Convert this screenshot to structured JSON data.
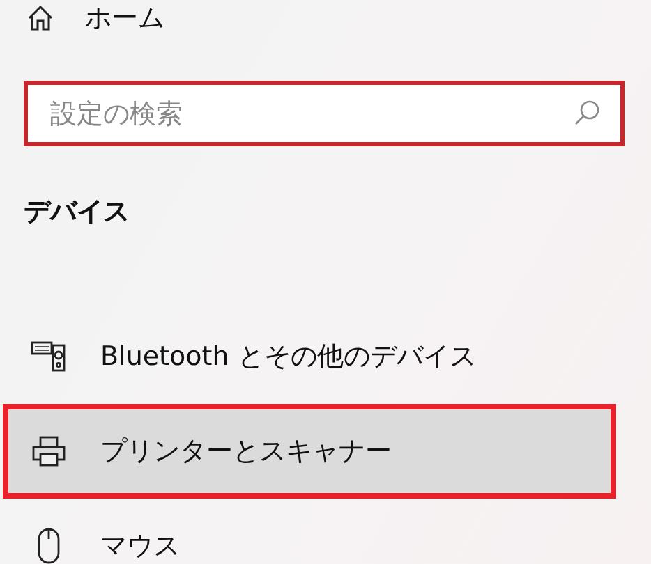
{
  "home": {
    "label": "ホーム"
  },
  "search": {
    "placeholder": "設定の検索",
    "highlighted": true
  },
  "section_title": "デバイス",
  "items": [
    {
      "kind": "bluetooth",
      "label": "Bluetooth とその他のデバイス",
      "selected": false,
      "highlighted": false
    },
    {
      "kind": "printer",
      "label": "プリンターとスキャナー",
      "selected": true,
      "highlighted": true
    },
    {
      "kind": "mouse",
      "label": "マウス",
      "selected": false,
      "highlighted": false
    }
  ]
}
